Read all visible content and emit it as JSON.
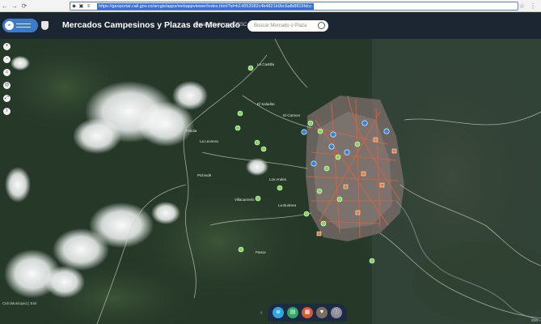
{
  "browser": {
    "back_icon": "arrow-left-icon",
    "forward_icon": "arrow-right-icon",
    "reload_icon": "reload-icon",
    "url": "https://geoportal.cali.gov.co/arcgis/apps/webappviewer/index.html?id=b14052082c4b4821b9bc6afb8815fdcc"
  },
  "header": {
    "title": "Mercados Campesinos y Plazas de Mercado",
    "byline": "Desarrollado por IDESC",
    "search_placeholder": "Buscar Mercado o Plaza"
  },
  "map": {
    "place_labels": [
      "La Castilla",
      "El Saladito",
      "Felidia",
      "La Leonera",
      "Pichindé",
      "Los Andes",
      "La Buitrera",
      "Pance",
      "Villacarmelo",
      "El Carmen"
    ],
    "attribution": "Cali (Municipio) | Esri",
    "esri_credit": "Esri",
    "colors": {
      "green_marker": "#7ed957",
      "blue_marker": "#2e86de",
      "orange_marker": "#e2803a",
      "urban_roads": "#d4653c"
    }
  },
  "widgets": {
    "left_tools": [
      "plus-icon",
      "minus-icon",
      "home-icon",
      "locate-icon",
      "fullscreen-icon",
      "info-icon"
    ],
    "dock": [
      "layer-list-icon",
      "legend-icon",
      "basemap-icon",
      "filter-icon",
      "about-icon"
    ]
  }
}
